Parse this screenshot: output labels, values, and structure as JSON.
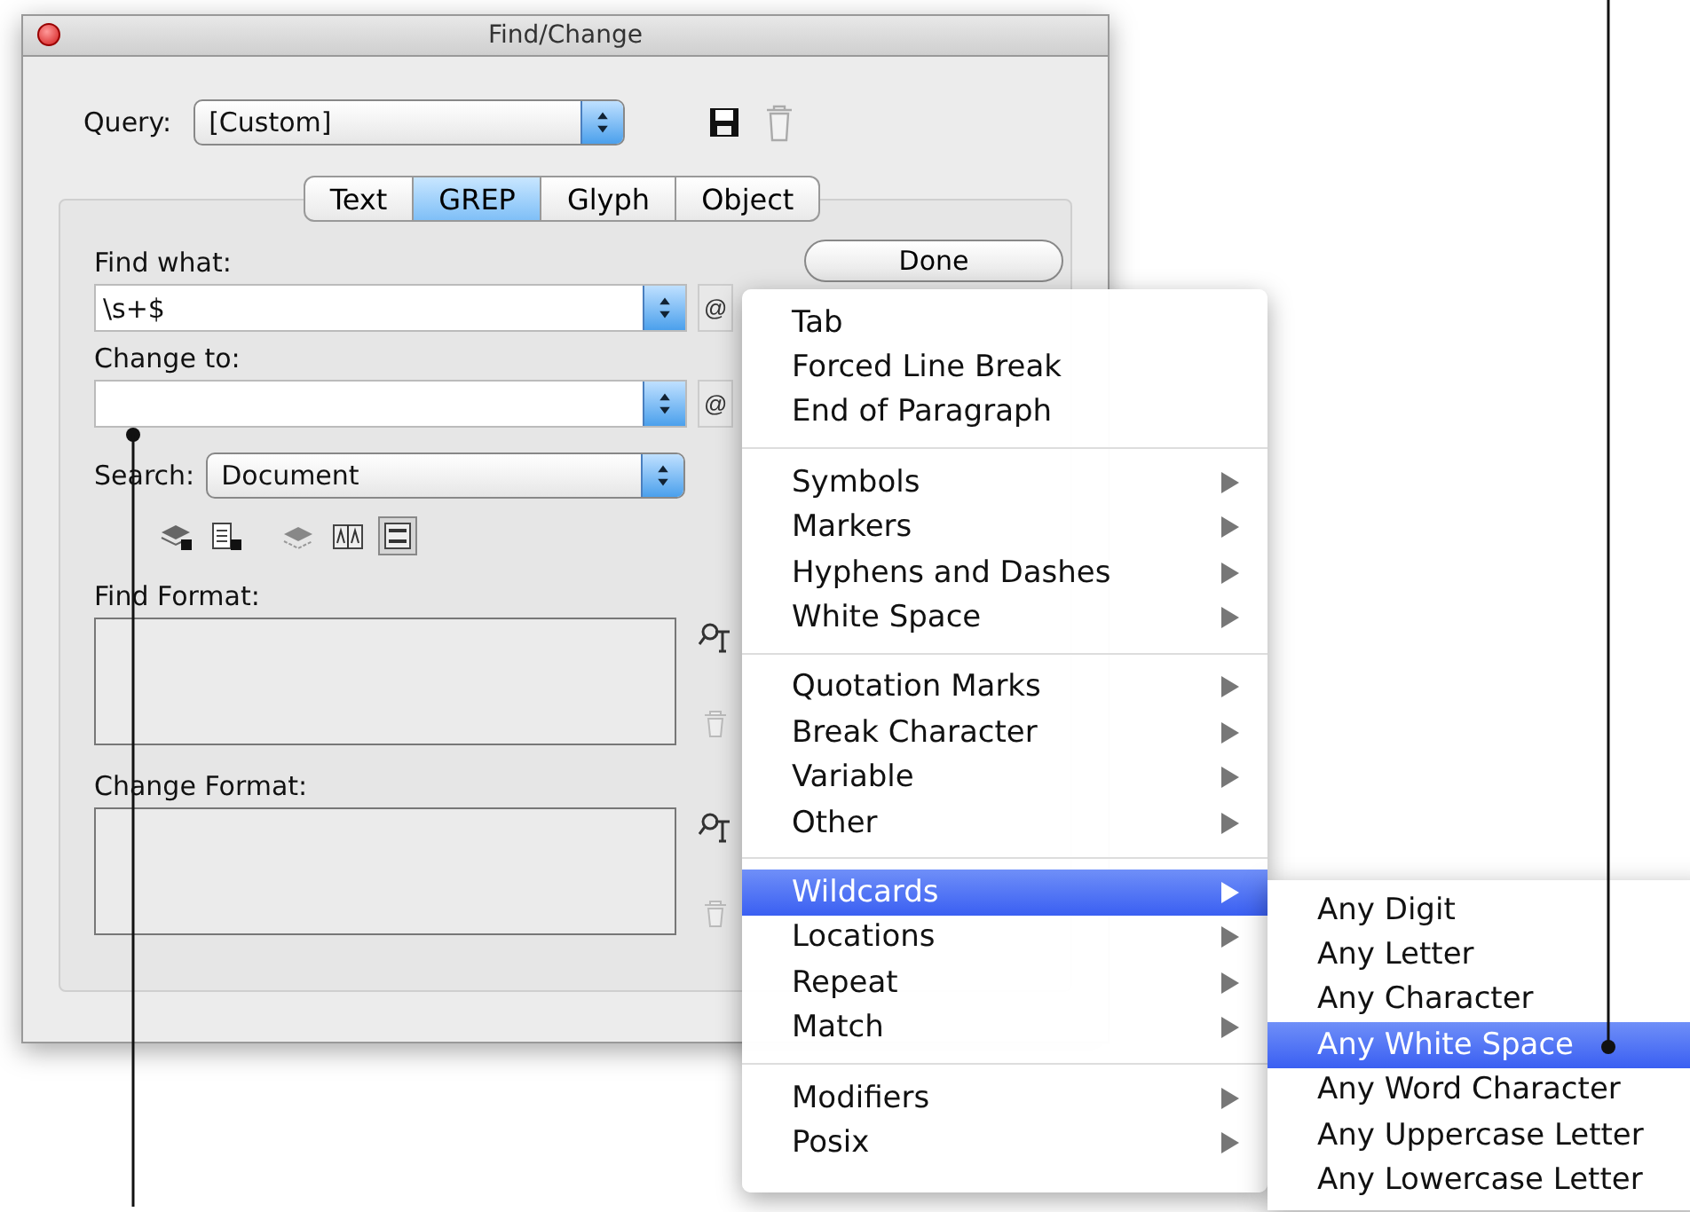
{
  "window": {
    "title": "Find/Change"
  },
  "query": {
    "label": "Query:",
    "value": "[Custom]"
  },
  "tabs": [
    {
      "label": "Text",
      "selected": false
    },
    {
      "label": "GREP",
      "selected": true
    },
    {
      "label": "Glyph",
      "selected": false
    },
    {
      "label": "Object",
      "selected": false
    }
  ],
  "find_what": {
    "label": "Find what:",
    "value": "\\s+$",
    "special_button": "@"
  },
  "change_to": {
    "label": "Change to:",
    "special_button": "@"
  },
  "search": {
    "label": "Search:",
    "value": "Document"
  },
  "search_options": [
    {
      "kind": "locked-layers",
      "selected": false
    },
    {
      "kind": "locked-stories",
      "selected": false
    },
    {
      "kind": "hidden-layers",
      "selected": false
    },
    {
      "kind": "case",
      "selected": false
    },
    {
      "kind": "whole-word",
      "selected": true
    }
  ],
  "find_format": {
    "label": "Find Format:"
  },
  "change_format": {
    "label": "Change Format:"
  },
  "buttons": [
    "Done"
  ],
  "menu": {
    "groups": [
      [
        {
          "label": "Tab",
          "submenu": false,
          "selected": false
        },
        {
          "label": "Forced Line Break",
          "submenu": false,
          "selected": false
        },
        {
          "label": "End of Paragraph",
          "submenu": false,
          "selected": false
        }
      ],
      [
        {
          "label": "Symbols",
          "submenu": true,
          "selected": false
        },
        {
          "label": "Markers",
          "submenu": true,
          "selected": false
        },
        {
          "label": "Hyphens and Dashes",
          "submenu": true,
          "selected": false
        },
        {
          "label": "White Space",
          "submenu": true,
          "selected": false
        }
      ],
      [
        {
          "label": "Quotation Marks",
          "submenu": true,
          "selected": false
        },
        {
          "label": "Break Character",
          "submenu": true,
          "selected": false
        },
        {
          "label": "Variable",
          "submenu": true,
          "selected": false
        },
        {
          "label": "Other",
          "submenu": true,
          "selected": false
        }
      ],
      [
        {
          "label": "Wildcards",
          "submenu": true,
          "selected": true
        },
        {
          "label": "Locations",
          "submenu": true,
          "selected": false
        },
        {
          "label": "Repeat",
          "submenu": true,
          "selected": false
        },
        {
          "label": "Match",
          "submenu": true,
          "selected": false
        }
      ],
      [
        {
          "label": "Modifiers",
          "submenu": true,
          "selected": false
        },
        {
          "label": "Posix",
          "submenu": true,
          "selected": false
        }
      ]
    ]
  },
  "submenu": {
    "items": [
      {
        "label": "Any Digit",
        "selected": false
      },
      {
        "label": "Any Letter",
        "selected": false
      },
      {
        "label": "Any Character",
        "selected": false
      },
      {
        "label": "Any White Space",
        "selected": true
      },
      {
        "label": "Any Word Character",
        "selected": false
      },
      {
        "label": "Any Uppercase Letter",
        "selected": false
      },
      {
        "label": "Any Lowercase Letter",
        "selected": false
      }
    ]
  }
}
